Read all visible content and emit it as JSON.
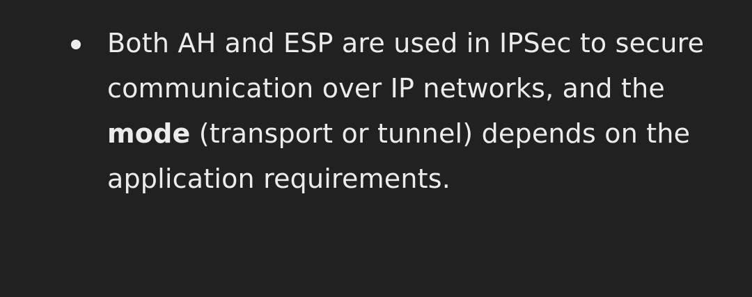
{
  "message": {
    "bullet": {
      "text_before": "Both AH and ESP are used in IPSec to secure communication over IP networks, and the ",
      "emphasis": "mode",
      "text_after": " (transport or tunnel) depends on the application requirements."
    }
  },
  "colors": {
    "background": "#212121",
    "text": "#ececec"
  }
}
